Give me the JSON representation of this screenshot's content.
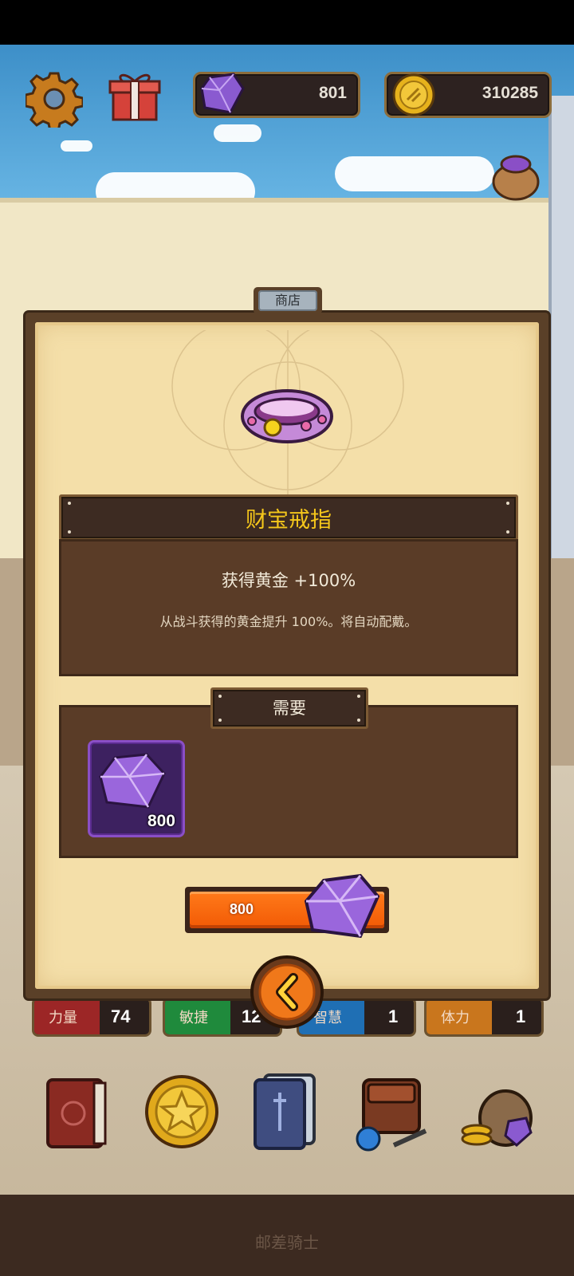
{
  "hud": {
    "gems": "801",
    "gold": "310285",
    "settings_icon": "gear-icon",
    "gift_icon": "gift-icon"
  },
  "shop": {
    "tab_label": "商店",
    "item_name": "财宝戒指",
    "effect": "获得黄金 +100%",
    "description": "从战斗获得的黄金提升 100%。将自动配戴。",
    "requirement_label": "需要",
    "requirement_count": "800",
    "buy_price": "800"
  },
  "stats": [
    {
      "label": "力量",
      "value": "74",
      "color": "#9c2626"
    },
    {
      "label": "敏捷",
      "value": "12",
      "color": "#1f8a3c"
    },
    {
      "label": "智慧",
      "value": "1",
      "color": "#1f6fb4"
    },
    {
      "label": "体力",
      "value": "1",
      "color": "#c9761d"
    }
  ],
  "bottom": {
    "label": "邮差骑士",
    "menu_icons": [
      "book-icon",
      "star-coin-icon",
      "card-deck-icon",
      "backpack-icon",
      "loot-bag-icon"
    ]
  },
  "colors": {
    "title_gold": "#f5c71b",
    "button_orange": "#f25a05",
    "gem_purple": "#8a4fc6"
  }
}
